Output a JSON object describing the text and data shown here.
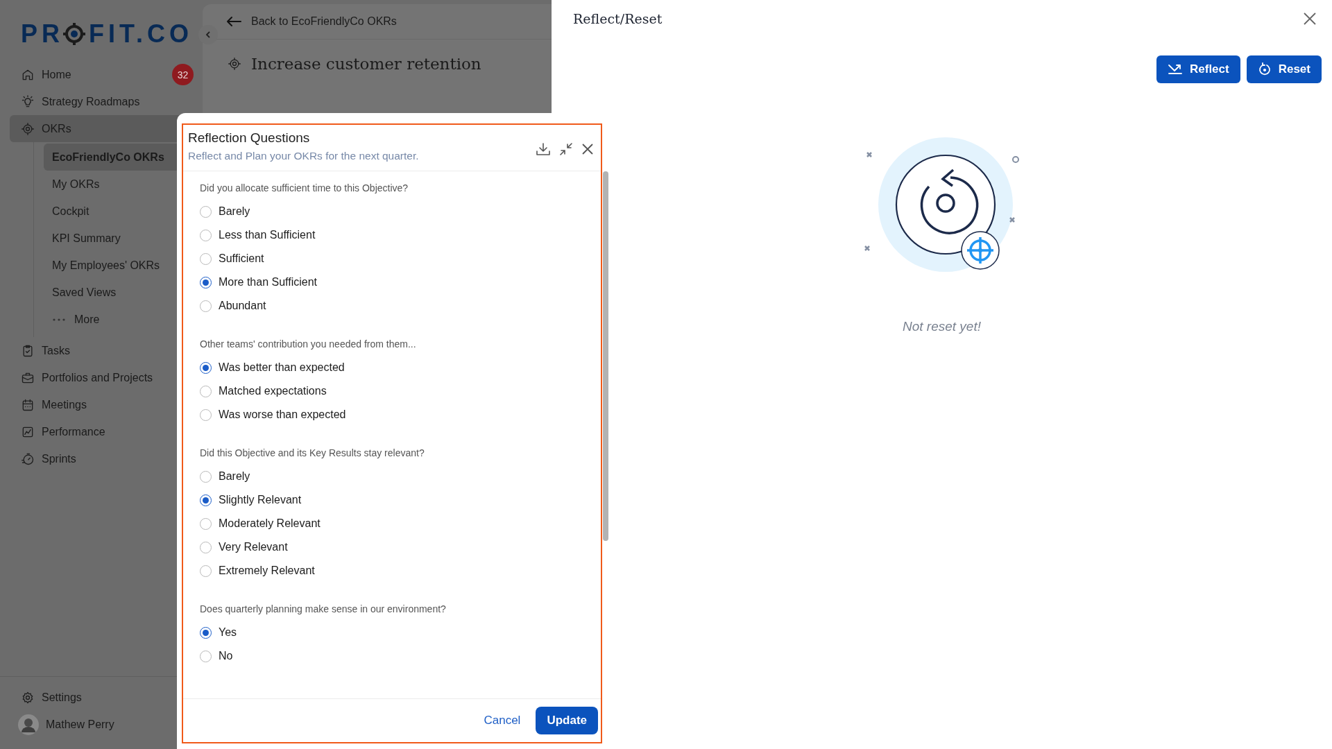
{
  "sidebar": {
    "logo": {
      "left": "PR",
      "right": "FIT.CO"
    },
    "items": [
      {
        "label": "Home",
        "kind": "home",
        "badge": "32",
        "selected": false
      },
      {
        "label": "Strategy Roadmaps",
        "kind": "bulb",
        "selected": false
      },
      {
        "label": "OKRs",
        "kind": "target",
        "selected": true,
        "children": [
          {
            "label": "EcoFriendlyCo OKRs",
            "kind": "link",
            "selected": true
          },
          {
            "label": "My OKRs",
            "kind": "link",
            "selected": false
          },
          {
            "label": "Cockpit",
            "kind": "link",
            "selected": false
          },
          {
            "label": "KPI Summary",
            "kind": "link",
            "selected": false
          },
          {
            "label": "My Employees' OKRs",
            "kind": "link",
            "selected": false
          },
          {
            "label": "Saved Views",
            "kind": "link",
            "selected": false
          },
          {
            "label": "More",
            "kind": "more",
            "selected": false
          }
        ]
      },
      {
        "label": "Tasks",
        "kind": "tasks",
        "selected": false
      },
      {
        "label": "Portfolios and Projects",
        "kind": "briefcase",
        "selected": false
      },
      {
        "label": "Meetings",
        "kind": "calendar",
        "selected": false
      },
      {
        "label": "Performance",
        "kind": "chart",
        "selected": false
      },
      {
        "label": "Sprints",
        "kind": "timer",
        "selected": false
      }
    ],
    "footer": [
      {
        "label": "Settings",
        "kind": "settings"
      },
      {
        "label": "Mathew Perry",
        "kind": "user"
      }
    ]
  },
  "main": {
    "back_link": "Back to EcoFriendlyCo OKRs",
    "objective": "Increase customer retention"
  },
  "modal": {
    "title": "Reflection Questions",
    "subtitle": "Reflect and Plan your OKRs for the next quarter.",
    "questions": [
      {
        "text": "Did you allocate sufficient time to this Objective?",
        "options": [
          {
            "label": "Barely",
            "selected": false
          },
          {
            "label": "Less than Sufficient",
            "selected": false
          },
          {
            "label": "Sufficient",
            "selected": false
          },
          {
            "label": "More than Sufficient",
            "selected": true
          },
          {
            "label": "Abundant",
            "selected": false
          }
        ]
      },
      {
        "text": "Other teams' contribution you needed from them...",
        "options": [
          {
            "label": "Was better than expected",
            "selected": true
          },
          {
            "label": "Matched expectations",
            "selected": false
          },
          {
            "label": "Was worse than expected",
            "selected": false
          }
        ]
      },
      {
        "text": "Did this Objective and its Key Results stay relevant?",
        "options": [
          {
            "label": "Barely",
            "selected": false
          },
          {
            "label": "Slightly Relevant",
            "selected": true
          },
          {
            "label": "Moderately Relevant",
            "selected": false
          },
          {
            "label": "Very Relevant",
            "selected": false
          },
          {
            "label": "Extremely Relevant",
            "selected": false
          }
        ]
      },
      {
        "text": "Does quarterly planning make sense in our environment?",
        "options": [
          {
            "label": "Yes",
            "selected": true
          },
          {
            "label": "No",
            "selected": false
          }
        ]
      }
    ],
    "cancel": "Cancel",
    "update": "Update"
  },
  "panel": {
    "title": "Reflect/Reset",
    "buttons": [
      {
        "label": "Reflect",
        "kind": "reflect"
      },
      {
        "label": "Reset",
        "kind": "reset"
      }
    ],
    "empty_message": "Not reset yet!"
  }
}
